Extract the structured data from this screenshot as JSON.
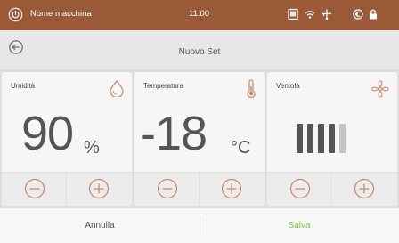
{
  "statusbar": {
    "machine_name": "Nome macchina",
    "time": "11:00",
    "icons": [
      "power-icon",
      "tablet-icon",
      "wifi-icon",
      "usb-icon",
      "coin-icon",
      "lock-icon"
    ]
  },
  "header": {
    "title": "Nuovo Set",
    "back_icon": "back-arrow-icon"
  },
  "cards": [
    {
      "label": "Umidità",
      "icon": "humidity-drop-icon",
      "value": "90",
      "unit": "%",
      "minus_icon": "minus-icon",
      "plus_icon": "plus-icon"
    },
    {
      "label": "Temperatura",
      "icon": "thermometer-icon",
      "value": "-18",
      "unit": "°C",
      "minus_icon": "minus-icon",
      "plus_icon": "plus-icon"
    },
    {
      "label": "Ventola",
      "icon": "fan-icon",
      "speed_level": 4,
      "speed_max": 5,
      "minus_icon": "minus-icon",
      "plus_icon": "plus-icon"
    }
  ],
  "footer": {
    "cancel_label": "Annulla",
    "save_label": "Salva"
  },
  "colors": {
    "statusbar_bg": "#9a5a37",
    "accent": "#c8866a",
    "save_green": "#7dc24a",
    "text_dark": "#555555",
    "bar_active": "#555555",
    "bar_inactive": "#c4c4c4"
  }
}
